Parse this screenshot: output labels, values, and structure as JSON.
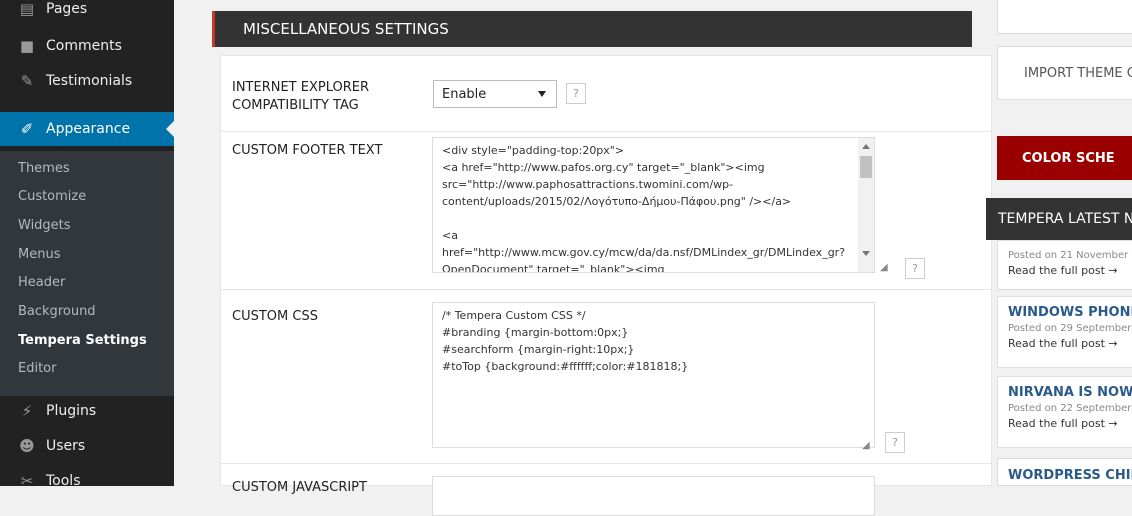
{
  "sidebar": {
    "top_items": [
      {
        "label": "Pages",
        "icon": "pages-icon"
      },
      {
        "label": "Comments",
        "icon": "comments-icon"
      },
      {
        "label": "Testimonials",
        "icon": "pin-icon"
      },
      {
        "label": "Appearance",
        "icon": "brush-icon"
      }
    ],
    "submenu": [
      "Themes",
      "Customize",
      "Widgets",
      "Menus",
      "Header",
      "Background",
      "Tempera Settings",
      "Editor"
    ],
    "bottom_items": [
      {
        "label": "Plugins",
        "icon": "plug-icon"
      },
      {
        "label": "Users",
        "icon": "users-icon"
      },
      {
        "label": "Tools",
        "icon": "wrench-icon"
      }
    ]
  },
  "section": {
    "title": "Miscellaneous Settings"
  },
  "settings": {
    "ie_label": "Internet Explorer Compatibility Tag",
    "ie_value": "Enable",
    "footer_label": "Custom Footer Text",
    "footer_lines": [
      "<div style=\"padding-top:20px\">",
      "<a href=\"http://www.pafos.org.cy\" target=\"_blank\"><img",
      "src=\"http://www.paphosattractions.twomini.com/wp-",
      "content/uploads/2015/02/Λογότυπο-Δήμου-Πάφου.png\" /></a>",
      "",
      "<a",
      "href=\"http://www.mcw.gov.cy/mcw/da/da.nsf/DMLindex_gr/DMLindex_gr?",
      "OpenDocument\" target=\"_blank\"><img"
    ],
    "css_label": "Custom CSS",
    "css_lines": [
      "/* Tempera Custom CSS */",
      "#branding {margin-bottom:0px;}",
      "#searchform {margin-right:10px;}",
      "#toTop {background:#ffffff;color:#181818;}"
    ],
    "js_label": "Custom JavaScript",
    "help_glyph": "?"
  },
  "right_column": {
    "import_label": "IMPORT THEME O",
    "color_label": "COLOR SCHE",
    "news_header": "TEMPERA LATEST N",
    "news": [
      {
        "title": "",
        "date": "Posted on 21 November",
        "link": "Read the full post →"
      },
      {
        "title": "WINDOWS PHONE",
        "date": "Posted on 29 September",
        "link": "Read the full post →"
      },
      {
        "title": "NIRVANA IS NOW",
        "date": "Posted on 22 September",
        "link": "Read the full post →"
      },
      {
        "title": "WORDPRESS CHIL",
        "date": "",
        "link": ""
      }
    ]
  }
}
